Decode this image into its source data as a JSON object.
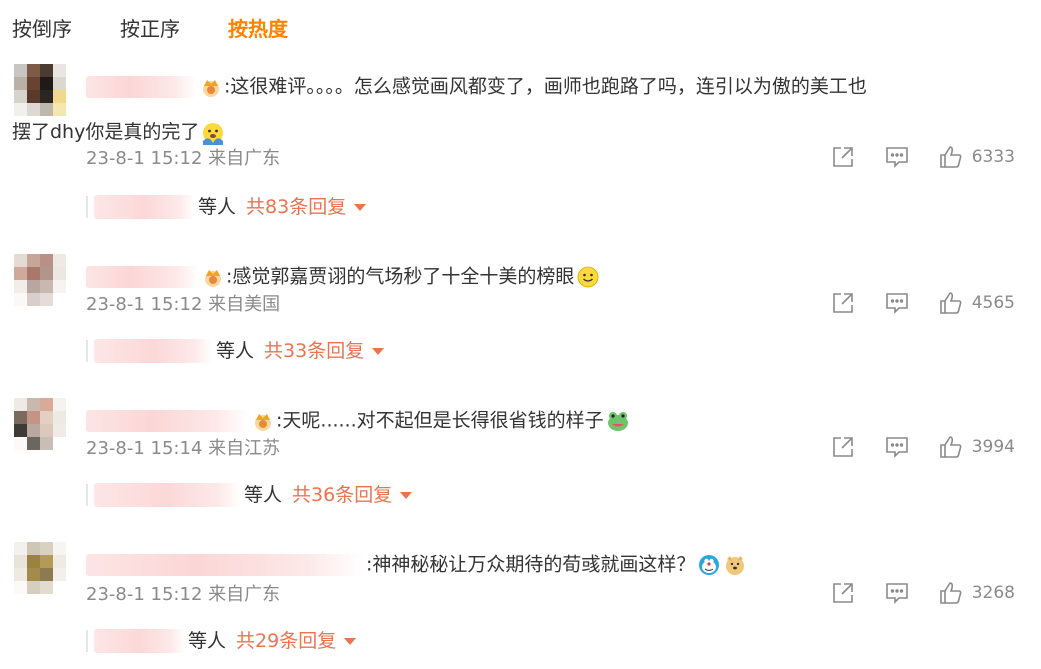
{
  "tabs": [
    {
      "label": "按倒序"
    },
    {
      "label": "按正序"
    },
    {
      "label": "按热度"
    }
  ],
  "colors": {
    "accent": "#ff8200",
    "reply": "#eb7350",
    "meta": "#8a8a8a"
  },
  "icons": {
    "share": "share-icon",
    "comment": "comment-icon",
    "like": "like-icon",
    "crown": "crown-badge-icon",
    "expand": "caret-down-icon"
  },
  "comments": [
    {
      "text": ":这很难评。。。。怎么感觉画风都变了，画师也跑路了吗，连引以为傲的美工也",
      "text_cont": "摆了dhy你是真的完了",
      "emoji": "face-with-hands-over-mouth",
      "time": "23-8-1 15:12 来自广东",
      "likes": "6333",
      "reply_suffix": "等人",
      "reply_count": "共83条回复"
    },
    {
      "text": ":感觉郭嘉贾诩的气场秒了十全十美的榜眼",
      "text_cont": "",
      "emoji": "smiling-face",
      "time": "23-8-1 15:12 来自美国",
      "likes": "4565",
      "reply_suffix": "等人",
      "reply_count": "共33条回复"
    },
    {
      "text": ":天呢......对不起但是长得很省钱的样子",
      "text_cont": "",
      "emoji": "frog-face",
      "time": "23-8-1 15:14 来自江苏",
      "likes": "3994",
      "reply_suffix": "等人",
      "reply_count": "共36条回复"
    },
    {
      "text": ":神神秘秘让万众期待的荀彧就画这样？",
      "text_cont": "",
      "emoji": "doraemon-and-doge",
      "time": "23-8-1 15:12 来自广东",
      "likes": "3268",
      "reply_suffix": "等人",
      "reply_count": "共29条回复"
    }
  ]
}
